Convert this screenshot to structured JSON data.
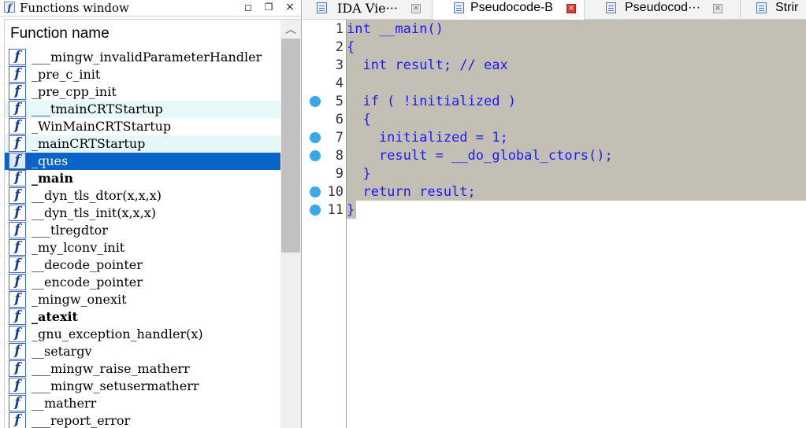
{
  "functions_window": {
    "title": "Functions window",
    "column_header": "Function name",
    "functions": [
      {
        "name": "___mingw_invalidParameterHandler",
        "state": "normal"
      },
      {
        "name": "_pre_c_init",
        "state": "normal"
      },
      {
        "name": "_pre_cpp_init",
        "state": "normal"
      },
      {
        "name": "___tmainCRTStartup",
        "state": "highlight"
      },
      {
        "name": "_WinMainCRTStartup",
        "state": "normal"
      },
      {
        "name": "_mainCRTStartup",
        "state": "highlight"
      },
      {
        "name": "_ques",
        "state": "selected"
      },
      {
        "name": "_main",
        "state": "bold"
      },
      {
        "name": "__dyn_tls_dtor(x,x,x)",
        "state": "normal"
      },
      {
        "name": "__dyn_tls_init(x,x,x)",
        "state": "normal"
      },
      {
        "name": "___tlregdtor",
        "state": "normal"
      },
      {
        "name": "_my_lconv_init",
        "state": "normal"
      },
      {
        "name": "__decode_pointer",
        "state": "normal"
      },
      {
        "name": "__encode_pointer",
        "state": "normal"
      },
      {
        "name": "_mingw_onexit",
        "state": "normal"
      },
      {
        "name": "_atexit",
        "state": "bold"
      },
      {
        "name": "_gnu_exception_handler(x)",
        "state": "normal"
      },
      {
        "name": "__setargv",
        "state": "normal"
      },
      {
        "name": "___mingw_raise_matherr",
        "state": "normal"
      },
      {
        "name": "___mingw_setusermatherr",
        "state": "normal"
      },
      {
        "name": "__matherr",
        "state": "normal"
      },
      {
        "name": "___report_error",
        "state": "normal"
      }
    ]
  },
  "tabs": [
    {
      "id": "tab-ida",
      "label": "IDA Vie···",
      "active": false
    },
    {
      "id": "tab-pseudo-b",
      "label": "Pseudocode-B",
      "active": true
    },
    {
      "id": "tab-pseudo-other",
      "label": "Pseudocod···",
      "active": false
    },
    {
      "id": "tab-strings",
      "label": "Strir",
      "active": false
    }
  ],
  "pseudocode": {
    "lines": [
      {
        "num": "1",
        "text": "int __main()",
        "breakpoint": false
      },
      {
        "num": "2",
        "text": "{",
        "breakpoint": false
      },
      {
        "num": "3",
        "text": "  int result; // eax",
        "breakpoint": false
      },
      {
        "num": "4",
        "text": "",
        "breakpoint": false
      },
      {
        "num": "5",
        "text": "  if ( !initialized )",
        "breakpoint": true
      },
      {
        "num": "6",
        "text": "  {",
        "breakpoint": false
      },
      {
        "num": "7",
        "text": "    initialized = 1;",
        "breakpoint": true
      },
      {
        "num": "8",
        "text": "    result = __do_global_ctors();",
        "breakpoint": true
      },
      {
        "num": "9",
        "text": "  }",
        "breakpoint": false
      },
      {
        "num": "10",
        "text": "  return result;",
        "breakpoint": true
      },
      {
        "num": "11",
        "text": "}",
        "breakpoint": true
      }
    ]
  },
  "colors": {
    "selection": "#c4bfb4",
    "code_text": "#1a1aff",
    "breakpoint": "#3aa8e8",
    "selected_row": "#0a64c8",
    "highlight_row": "#e6f8f8"
  }
}
